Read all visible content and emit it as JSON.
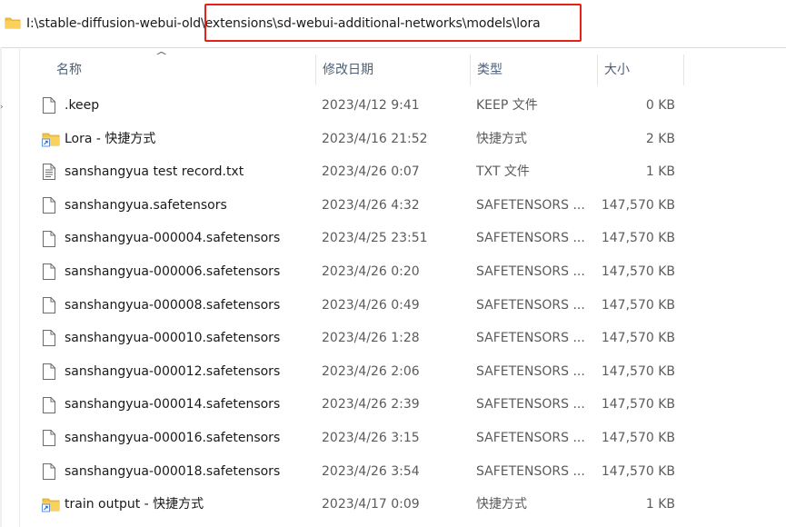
{
  "address_bar": {
    "path": "I:\\stable-diffusion-webui-old\\extensions\\sd-webui-additional-networks\\models\\lora",
    "icon": "folder-icon",
    "highlight_color": "#e62117"
  },
  "columns": {
    "name": "名称",
    "date": "修改日期",
    "type": "类型",
    "size": "大小"
  },
  "files": [
    {
      "icon": "file-icon",
      "name": ".keep",
      "date": "2023/4/12 9:41",
      "type": "KEEP 文件",
      "size": "0 KB"
    },
    {
      "icon": "folder-shortcut-icon",
      "name": "Lora - 快捷方式",
      "date": "2023/4/16 21:52",
      "type": "快捷方式",
      "size": "2 KB"
    },
    {
      "icon": "text-file-icon",
      "name": "sanshangyua test record.txt",
      "date": "2023/4/26 0:07",
      "type": "TXT 文件",
      "size": "1 KB"
    },
    {
      "icon": "file-icon",
      "name": "sanshangyua.safetensors",
      "date": "2023/4/26 4:32",
      "type": "SAFETENSORS ...",
      "size": "147,570 KB"
    },
    {
      "icon": "file-icon",
      "name": "sanshangyua-000004.safetensors",
      "date": "2023/4/25 23:51",
      "type": "SAFETENSORS ...",
      "size": "147,570 KB"
    },
    {
      "icon": "file-icon",
      "name": "sanshangyua-000006.safetensors",
      "date": "2023/4/26 0:20",
      "type": "SAFETENSORS ...",
      "size": "147,570 KB"
    },
    {
      "icon": "file-icon",
      "name": "sanshangyua-000008.safetensors",
      "date": "2023/4/26 0:49",
      "type": "SAFETENSORS ...",
      "size": "147,570 KB"
    },
    {
      "icon": "file-icon",
      "name": "sanshangyua-000010.safetensors",
      "date": "2023/4/26 1:28",
      "type": "SAFETENSORS ...",
      "size": "147,570 KB"
    },
    {
      "icon": "file-icon",
      "name": "sanshangyua-000012.safetensors",
      "date": "2023/4/26 2:06",
      "type": "SAFETENSORS ...",
      "size": "147,570 KB"
    },
    {
      "icon": "file-icon",
      "name": "sanshangyua-000014.safetensors",
      "date": "2023/4/26 2:39",
      "type": "SAFETENSORS ...",
      "size": "147,570 KB"
    },
    {
      "icon": "file-icon",
      "name": "sanshangyua-000016.safetensors",
      "date": "2023/4/26 3:15",
      "type": "SAFETENSORS ...",
      "size": "147,570 KB"
    },
    {
      "icon": "file-icon",
      "name": "sanshangyua-000018.safetensors",
      "date": "2023/4/26 3:54",
      "type": "SAFETENSORS ...",
      "size": "147,570 KB"
    },
    {
      "icon": "folder-shortcut-icon",
      "name": "train output - 快捷方式",
      "date": "2023/4/17 0:09",
      "type": "快捷方式",
      "size": "1 KB"
    }
  ]
}
